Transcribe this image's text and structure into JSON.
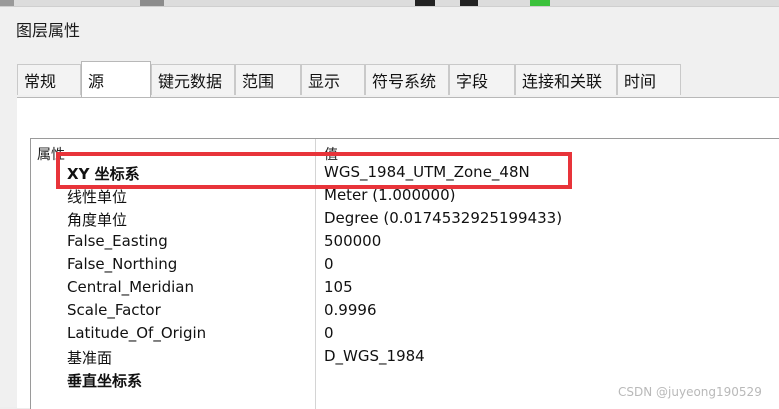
{
  "window": {
    "title": "图层属性"
  },
  "tabs": [
    {
      "label": "常规",
      "active": false
    },
    {
      "label": "源",
      "active": true
    },
    {
      "label": "键元数据",
      "active": false
    },
    {
      "label": "范围",
      "active": false
    },
    {
      "label": "显示",
      "active": false
    },
    {
      "label": "符号系统",
      "active": false
    },
    {
      "label": "字段",
      "active": false
    },
    {
      "label": "连接和关联",
      "active": false
    },
    {
      "label": "时间",
      "active": false
    }
  ],
  "table": {
    "headers": {
      "property": "属性",
      "value": "值"
    },
    "rows": [
      {
        "name": "XY 坐标系",
        "value": "WGS_1984_UTM_Zone_48N",
        "bold": true
      },
      {
        "name": "线性单位",
        "value": "Meter (1.000000)",
        "bold": false
      },
      {
        "name": "角度单位",
        "value": "Degree (0.0174532925199433)",
        "bold": false
      },
      {
        "name": "False_Easting",
        "value": "500000",
        "bold": false
      },
      {
        "name": "False_Northing",
        "value": "0",
        "bold": false
      },
      {
        "name": "Central_Meridian",
        "value": "105",
        "bold": false
      },
      {
        "name": "Scale_Factor",
        "value": "0.9996",
        "bold": false
      },
      {
        "name": "Latitude_Of_Origin",
        "value": "0",
        "bold": false
      },
      {
        "name": "基准面",
        "value": "D_WGS_1984",
        "bold": false
      },
      {
        "name": "垂直坐标系",
        "value": "",
        "bold": true
      }
    ]
  },
  "highlight_color": "#e8343a",
  "watermark": "CSDN @juyeong190529"
}
